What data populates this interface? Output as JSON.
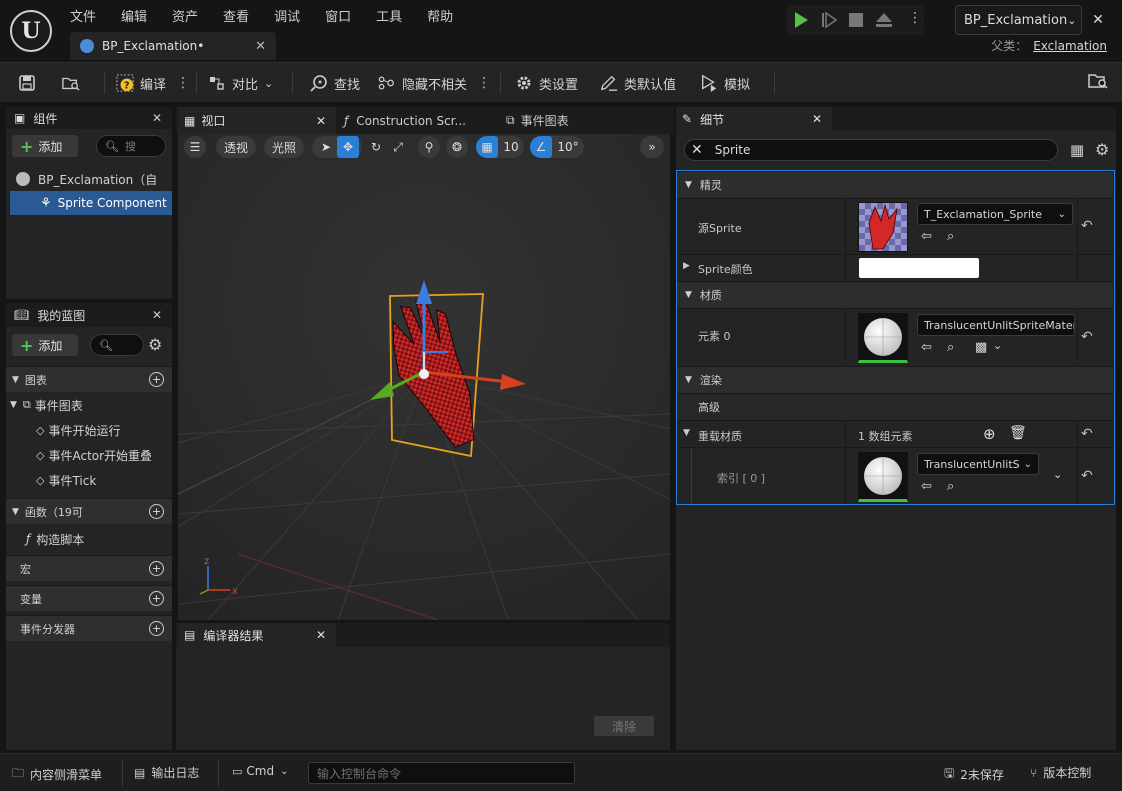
{
  "app": {
    "logo": "U",
    "menu": [
      "文件",
      "编辑",
      "资产",
      "查看",
      "调试",
      "窗口",
      "工具",
      "帮助"
    ],
    "doc_tab": "BP_Exclamation•",
    "parent_label": "父类：",
    "parent_value": "Exclamation"
  },
  "toolbar": {
    "compile": "编译",
    "diff": "对比",
    "find": "查找",
    "hide_unrelated": "隐藏不相关",
    "class_settings": "类设置",
    "class_defaults": "类默认值",
    "simulate": "模拟",
    "bp_select": "BP_Exclamation"
  },
  "components_panel": {
    "title": "组件",
    "add": "添加",
    "search_placeholder": "搜",
    "root": "BP_Exclamation（自",
    "child": "Sprite Component"
  },
  "myblueprint_panel": {
    "title": "我的蓝图",
    "add": "添加",
    "graphs": "图表",
    "event_graph": "事件图表",
    "events": [
      "事件开始运行",
      "事件Actor开始重叠",
      "事件Tick"
    ],
    "functions": "函数（19可",
    "construction": "构造脚本",
    "macros": "宏",
    "variables": "变量",
    "dispatchers": "事件分发器"
  },
  "center_tabs": {
    "viewport": "视口",
    "construction": "Construction Scr...",
    "event_graph": "事件图表"
  },
  "viewport": {
    "perspective": "透视",
    "lit": "光照",
    "grid_snap": "10",
    "rot_snap": "10°"
  },
  "compiler": {
    "title": "编译器结果",
    "clear": "清除"
  },
  "details": {
    "title": "细节",
    "search": "Sprite",
    "cat_sprite": "精灵",
    "source_sprite_label": "源Sprite",
    "source_sprite_value": "T_Exclamation_Sprite",
    "sprite_color_label": "Sprite颜色",
    "cat_material": "材质",
    "element0_label": "元素 0",
    "element0_value": "TranslucentUnlitSpriteMateria",
    "cat_render": "渲染",
    "cat_advanced": "高级",
    "override_label": "重载材质",
    "override_value": "1 数组元素",
    "index_label": "索引 [ 0 ]",
    "index_value": "TranslucentUnlitS"
  },
  "statusbar": {
    "content_drawer": "内容侧滑菜单",
    "output_log": "输出日志",
    "cmd": "Cmd",
    "console_placeholder": "输入控制台命令",
    "unsaved": "2未保存",
    "source_control": "版本控制"
  },
  "colors": {
    "accent_blue": "#2a7fd6",
    "play_green": "#55c04a",
    "selection": "#2a5a94",
    "sprite_red": "#cc2a2a",
    "bounds_orange": "#e8a020"
  }
}
